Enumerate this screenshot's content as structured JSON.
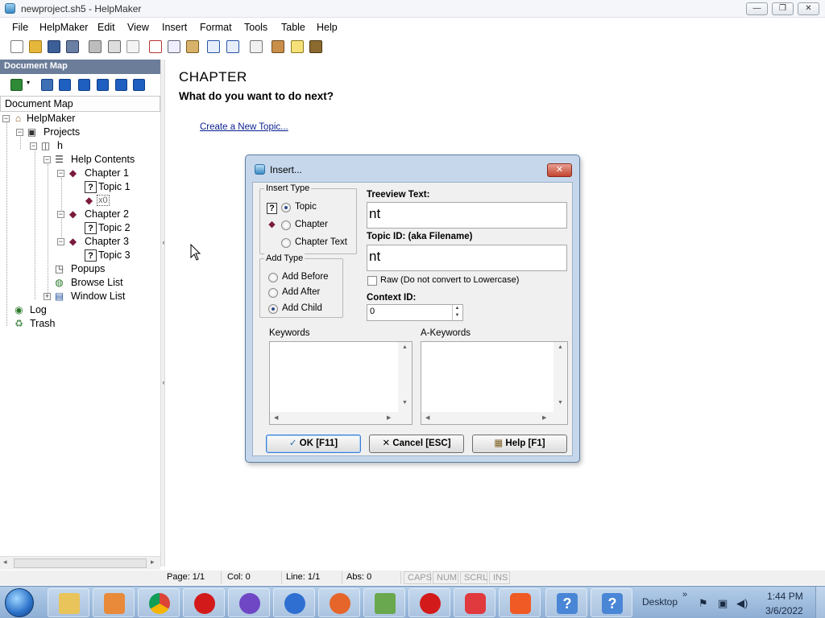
{
  "window": {
    "title": "newproject.sh5 - HelpMaker",
    "minimize_glyph": "—",
    "maximize_glyph": "❐",
    "close_glyph": "✕"
  },
  "menubar": [
    "File",
    "HelpMaker",
    "Edit",
    "View",
    "Insert",
    "Format",
    "Tools",
    "Table",
    "Help"
  ],
  "toolbar": {
    "icons": [
      "new-document-icon",
      "open-folder-icon",
      "save-icon",
      "save-all-icon",
      "print-icon",
      "print-preview-icon",
      "spell-check-icon",
      "cut-icon",
      "copy-icon",
      "paste-icon",
      "undo-icon",
      "redo-icon",
      "format-icon",
      "insert-image-icon",
      "help-topic-icon",
      "book-icon"
    ]
  },
  "document_map": {
    "header": "Document Map",
    "panel_title": "Document Map",
    "tree": [
      {
        "label": "HelpMaker",
        "icon": "home-icon",
        "expander": "−"
      },
      {
        "label": "Projects",
        "icon": "projects-icon",
        "expander": "−"
      },
      {
        "label": "h",
        "icon": "project-icon",
        "expander": "−"
      },
      {
        "label": "Help Contents",
        "icon": "contents-icon",
        "expander": "−"
      },
      {
        "label": "Chapter 1",
        "icon": "book-icon",
        "expander": "−"
      },
      {
        "label": "Topic 1",
        "icon": "topic-icon",
        "expander": ""
      },
      {
        "label": "x0",
        "icon": "book-icon",
        "expander": ""
      },
      {
        "label": "Chapter 2",
        "icon": "book-icon",
        "expander": "−"
      },
      {
        "label": "Topic 2",
        "icon": "topic-icon",
        "expander": ""
      },
      {
        "label": "Chapter 3",
        "icon": "book-icon",
        "expander": "−"
      },
      {
        "label": "Topic 3",
        "icon": "topic-icon",
        "expander": ""
      },
      {
        "label": "Popups",
        "icon": "popups-icon",
        "expander": ""
      },
      {
        "label": "Browse List",
        "icon": "browse-list-icon",
        "expander": ""
      },
      {
        "label": "Window List",
        "icon": "window-list-icon",
        "expander": "+"
      },
      {
        "label": "Log",
        "icon": "log-icon",
        "expander": ""
      },
      {
        "label": "Trash",
        "icon": "trash-icon",
        "expander": ""
      }
    ]
  },
  "content": {
    "heading": "CHAPTER",
    "subheading": "What do you want to do next?",
    "link": "Create a New Topic..."
  },
  "dialog": {
    "title": "Insert...",
    "close_glyph": "✕",
    "insert_type": {
      "legend": "Insert Type",
      "options": [
        "Topic",
        "Chapter",
        "Chapter Text"
      ],
      "selected": "Topic"
    },
    "add_type": {
      "legend": "Add Type",
      "options": [
        "Add Before",
        "Add After",
        "Add Child"
      ],
      "selected": "Add Child"
    },
    "treeview_text": {
      "label": "Treeview Text:",
      "value": "nt"
    },
    "topic_id": {
      "label": "Topic ID: (aka Filename)",
      "value": "nt"
    },
    "raw_checkbox": {
      "label": "Raw (Do not convert to Lowercase)",
      "checked": false
    },
    "context_id": {
      "label": "Context ID:",
      "value": "0"
    },
    "keywords_label": "Keywords",
    "a_keywords_label": "A-Keywords",
    "buttons": {
      "ok": "OK [F11]",
      "cancel": "Cancel [ESC]",
      "help": "Help [F1]"
    }
  },
  "statusbar": {
    "page": "Page: 1/1",
    "col": "Col: 0",
    "line": "Line: 1/1",
    "abs": "Abs: 0",
    "caps": "CAPS",
    "num": "NUM",
    "scrl": "SCRL",
    "ins": "INS"
  },
  "taskbar": {
    "apps": [
      "file-explorer-icon",
      "media-player-icon",
      "chrome-icon",
      "opera-icon",
      "firefox-icon",
      "firefox-dev-icon",
      "firefox-nightly-icon",
      "helpmaker-icon",
      "opera-gx-icon",
      "vivaldi-icon",
      "brave-icon",
      "help-icon",
      "help-icon-2"
    ],
    "desktop_label": "Desktop",
    "expand_glyph": "»",
    "time": "1:44 PM",
    "date": "3/6/2022"
  },
  "colors": {
    "dialog_frame": "#c6d7ec",
    "doc_map_header": "#6b7d99",
    "link": "#0a1f8f",
    "taskbar": "#b3cde9"
  }
}
